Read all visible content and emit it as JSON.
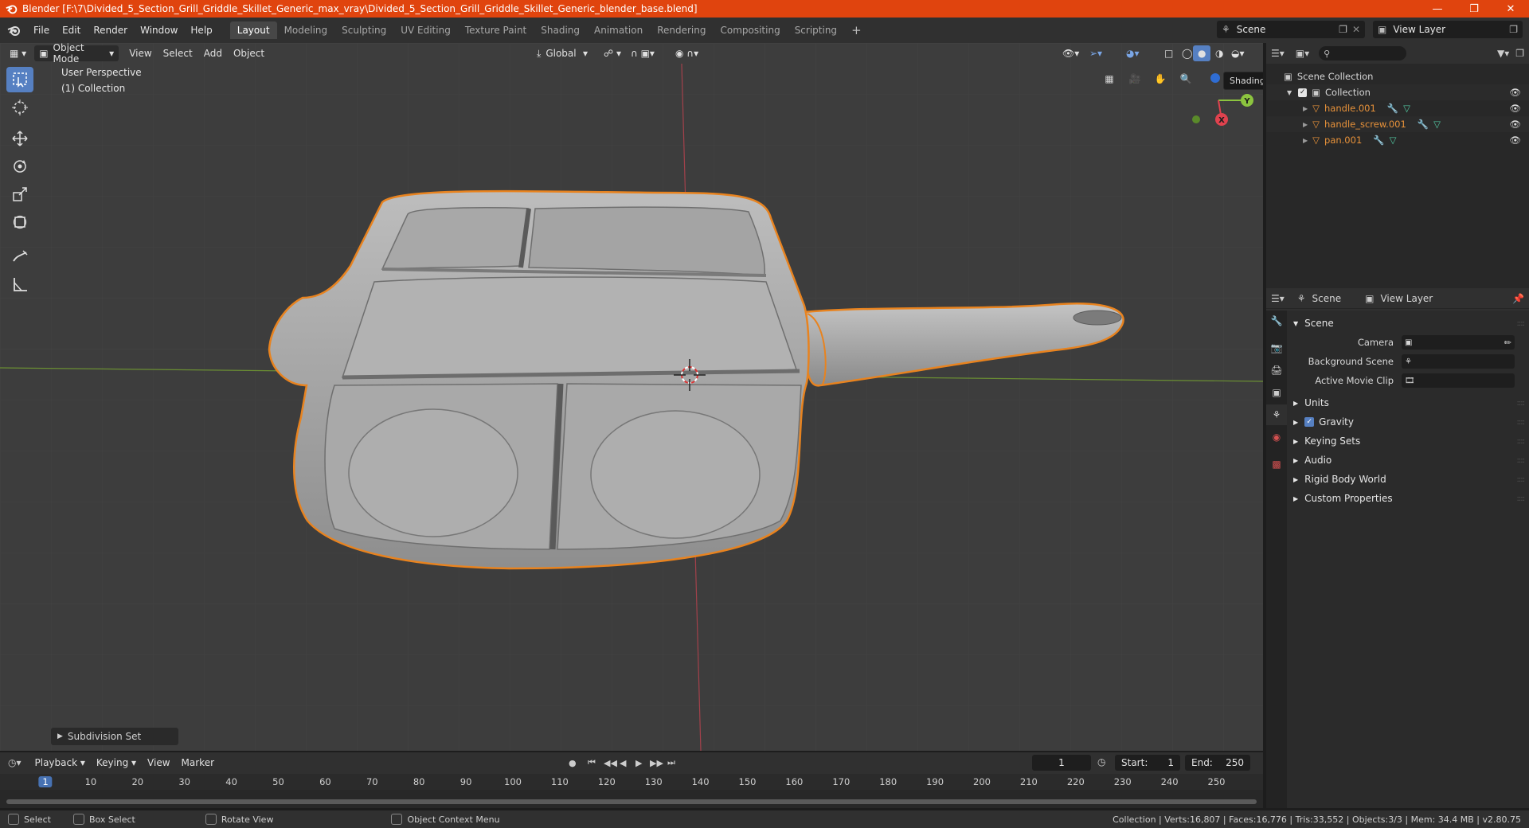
{
  "window": {
    "title": "Blender [F:\\7\\Divided_5_Section_Grill_Griddle_Skillet_Generic_max_vray\\Divided_5_Section_Grill_Griddle_Skillet_Generic_blender_base.blend]"
  },
  "menu": [
    "File",
    "Edit",
    "Render",
    "Window",
    "Help"
  ],
  "workspaces": [
    "Layout",
    "Modeling",
    "Sculpting",
    "UV Editing",
    "Texture Paint",
    "Shading",
    "Animation",
    "Rendering",
    "Compositing",
    "Scripting"
  ],
  "scene_name": "Scene",
  "view_layer_name": "View Layer",
  "viewport": {
    "mode": "Object Mode",
    "menus": [
      "View",
      "Select",
      "Add",
      "Object"
    ],
    "orientation": "Global",
    "perspective_label": "User Perspective",
    "collection_label": "(1) Collection",
    "tooltip": "Shading.",
    "last_operator": "Subdivision Set",
    "gizmo": {
      "x": "X",
      "y": "Y"
    }
  },
  "outliner": {
    "root": "Scene Collection",
    "collection": "Collection",
    "objects": [
      "handle.001",
      "handle_screw.001",
      "pan.001"
    ]
  },
  "properties": {
    "tab_scene": "Scene",
    "tab_view_layer": "View Layer",
    "panel": "Scene",
    "camera_label": "Camera",
    "background_label": "Background Scene",
    "movie_clip_label": "Active Movie Clip",
    "subpanels": [
      "Units",
      "Gravity",
      "Keying Sets",
      "Audio",
      "Rigid Body World",
      "Custom Properties"
    ]
  },
  "timeline": {
    "menus": [
      "Playback",
      "Keying",
      "View",
      "Marker"
    ],
    "current_frame": "1",
    "start_label": "Start:",
    "start": "1",
    "end_label": "End:",
    "end": "250",
    "ruler": [
      "1",
      "10",
      "20",
      "30",
      "40",
      "50",
      "60",
      "70",
      "80",
      "90",
      "100",
      "110",
      "120",
      "130",
      "140",
      "150",
      "160",
      "170",
      "180",
      "190",
      "200",
      "210",
      "220",
      "230",
      "240",
      "250"
    ]
  },
  "status": {
    "select": "Select",
    "box_select": "Box Select",
    "rotate": "Rotate View",
    "context": "Object Context Menu",
    "stats": "Collection | Verts:16,807 | Faces:16,776 | Tris:33,552 | Objects:3/3 | Mem: 34.4 MB | v2.80.75"
  },
  "colors": {
    "accent": "#e0440e",
    "selection_outline": "#e8831f",
    "active_tool": "#5680c2",
    "object_name": "#e8923a"
  }
}
